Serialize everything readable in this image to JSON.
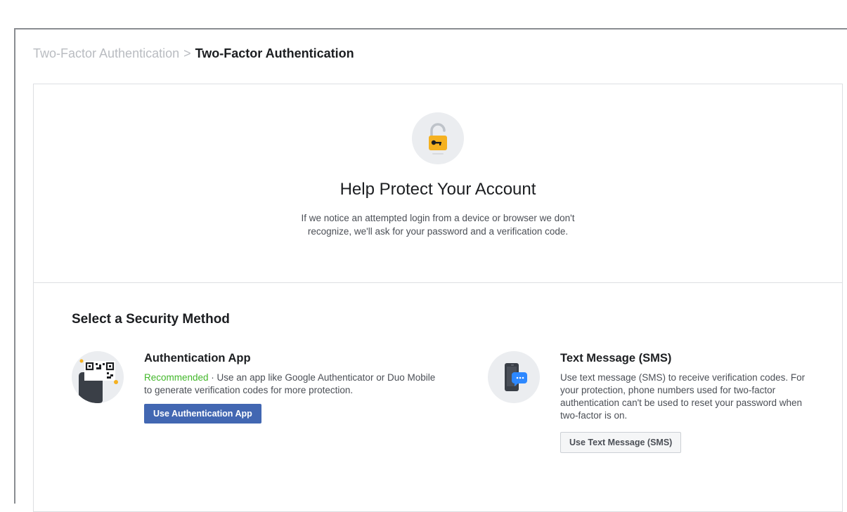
{
  "breadcrumb": {
    "parent": "Two-Factor Authentication",
    "separator": ">",
    "current": "Two-Factor Authentication"
  },
  "hero": {
    "icon": "padlock-key-icon",
    "title": "Help Protect Your Account",
    "description": "If we notice an attempted login from a device or browser we don't recognize, we'll ask for your password and a verification code."
  },
  "methods": {
    "title": "Select a Security Method",
    "items": [
      {
        "icon": "qr-code-phone-icon",
        "title": "Authentication App",
        "recommended": "Recommended",
        "description": " · Use an app like Google Authenticator or Duo Mobile to generate verification codes for more protection.",
        "button": "Use Authentication App"
      },
      {
        "icon": "phone-message-icon",
        "title": "Text Message (SMS)",
        "description": "Use text message (SMS) to receive verification codes. For your protection, phone numbers used for two-factor authentication can't be used to reset your password when two-factor is on.",
        "button": "Use Text Message (SMS)"
      }
    ]
  },
  "colors": {
    "primary_button": "#4267b2",
    "recommended": "#42b72a",
    "lock_yellow": "#f5b120"
  }
}
